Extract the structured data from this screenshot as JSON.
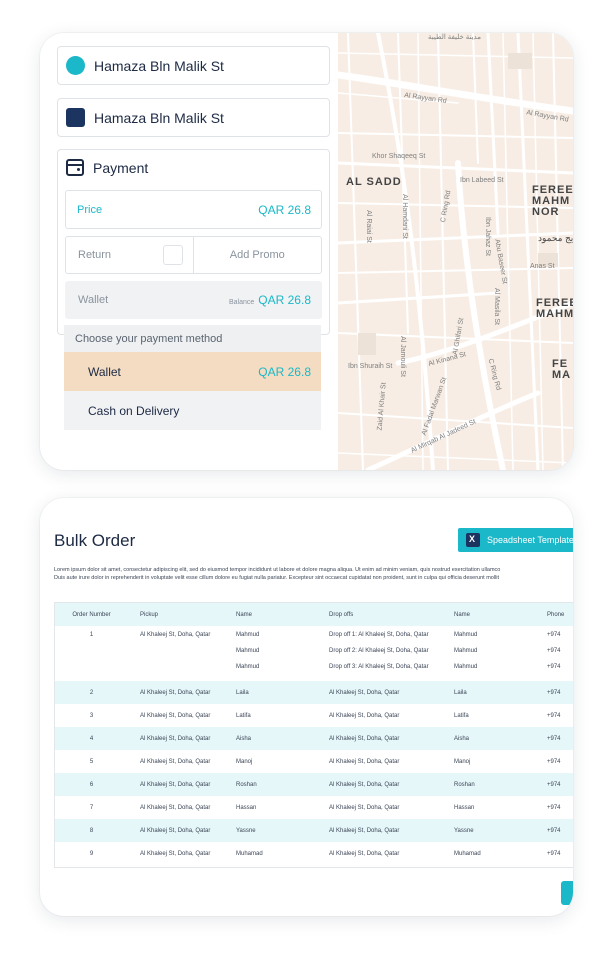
{
  "addresses": [
    {
      "label": "Hamaza Bln Malik St",
      "marker": "pickup-circle",
      "color": "#1ab8c9"
    },
    {
      "label": "Hamaza Bln Malik St",
      "marker": "dropoff-square",
      "color": "#1c3460"
    }
  ],
  "payment": {
    "title": "Payment",
    "price_label": "Price",
    "price_value": "QAR 26.8",
    "return_label": "Return",
    "promo_label": "Add Promo",
    "wallet_label": "Wallet",
    "balance_label": "Balance",
    "balance_value": "QAR 26.8",
    "method_title": "Choose your payment method",
    "methods": [
      {
        "label": "Wallet",
        "value": "QAR 26.8",
        "selected": true
      },
      {
        "label": "Cash on Delivery",
        "value": "",
        "selected": false
      }
    ]
  },
  "map": {
    "labels": {
      "top": "مدينة خليفة الطيبة",
      "al_rayyan_rd": "Al Rayyan Rd",
      "al_rayyan_rd2": "Al Rayyan Rd",
      "khor_shaqeeq": "Khor Shaqeeq St",
      "al_sadd": "AL SADD",
      "ibn_labeed": "Ibn Labeed St",
      "c_ring_rd": "C Ring Rd",
      "c_ring_rd2": "C Ring Rd",
      "fereej1": "FEREE MAHM NOR",
      "fereej_ar": "فريج محمود",
      "anas": "Anas St",
      "fereej2": "FEREE MAHM",
      "fereej3": "FE MA",
      "al_kinana": "Al Kinana St",
      "ibn_shuraih": "Ibn Shuraih St",
      "al_mirqab": "Al Mirqab Al Jadeed St",
      "al_fadal": "Al Fadal Marwan St",
      "zaid_al_khair": "Zaid Al Khair St",
      "al_hamdani": "Al Hamdani St",
      "al_raiai": "Al Raiai St",
      "al_jamouli": "Al Jamouli St",
      "al_masila": "Al Masila St",
      "ibn_jahaz": "Ibn Jahaz St",
      "abu_baseer": "Abu Baseer St",
      "al_ghifari": "Al Ghifari St"
    }
  },
  "bulk": {
    "title": "Bulk Order",
    "sheet_button": "Speadsheet Template",
    "sheet_icon": "excel-icon",
    "lorem1": "Lorem ipsum dolor sit amet, consectetur adipiscing elit, sed do eiusmod tempor incididunt ut labore et dolore magna aliqua. Ut enim ad minim veniam, quis nostrud exercitation ullamco",
    "lorem2": "Duis aute irure dolor in reprehenderit in voluptate velit esse cillum dolore eu fugiat nulla pariatur. Excepteur sint occaecat cupidatat non proident, sunt in culpa qui officia deserunt mollit",
    "columns": [
      "Order Number",
      "Pickup",
      "Name",
      "Drop offs",
      "Name",
      "Phone"
    ],
    "first_row": {
      "num": "1",
      "pickup": "Al Khaleej St, Doha, Qatar",
      "names": [
        "Mahmud",
        "Mahmud",
        "Mahmud"
      ],
      "drops": [
        "Drop off 1:  Al Khaleej St, Doha, Qatar",
        "Drop off 2:  Al Khaleej St, Doha, Qatar",
        "Drop off 3:  Al Khaleej St, Doha, Qatar"
      ],
      "names2": [
        "Mahmud",
        "Mahmud",
        "Mahmud"
      ],
      "phones": [
        "+974",
        "+974",
        "+974"
      ]
    },
    "rows": [
      {
        "num": "2",
        "pickup": "Al Khaleej St, Doha, Qatar",
        "name": "Laila",
        "drop": "Al Khaleej St, Doha, Qatar",
        "name2": "Laila",
        "phone": "+974"
      },
      {
        "num": "3",
        "pickup": "Al Khaleej St, Doha, Qatar",
        "name": "Latifa",
        "drop": "Al Khaleej St, Doha, Qatar",
        "name2": "Latifa",
        "phone": "+974"
      },
      {
        "num": "4",
        "pickup": "Al Khaleej St, Doha, Qatar",
        "name": "Aisha",
        "drop": "Al Khaleej St, Doha, Qatar",
        "name2": "Aisha",
        "phone": "+974"
      },
      {
        "num": "5",
        "pickup": "Al Khaleej St, Doha, Qatar",
        "name": "Manoj",
        "drop": "Al Khaleej St, Doha, Qatar",
        "name2": "Manoj",
        "phone": "+974"
      },
      {
        "num": "6",
        "pickup": "Al Khaleej St, Doha, Qatar",
        "name": "Roshan",
        "drop": "Al Khaleej St, Doha, Qatar",
        "name2": "Roshan",
        "phone": "+974"
      },
      {
        "num": "7",
        "pickup": "Al Khaleej St, Doha, Qatar",
        "name": "Hassan",
        "drop": "Al Khaleej St, Doha, Qatar",
        "name2": "Hassan",
        "phone": "+974"
      },
      {
        "num": "8",
        "pickup": "Al Khaleej St, Doha, Qatar",
        "name": "Yassne",
        "drop": "Al Khaleej St, Doha, Qatar",
        "name2": "Yassne",
        "phone": "+974"
      },
      {
        "num": "9",
        "pickup": "Al Khaleej St, Doha, Qatar",
        "name": "Muhamad",
        "drop": "Al Khaleej St, Doha, Qatar",
        "name2": "Muhamad",
        "phone": "+974"
      }
    ]
  },
  "colors": {
    "accent": "#1ab8c9",
    "navy": "#1c3460",
    "selected_method": "#f3dcc2",
    "row_alt": "#e6f7f9"
  }
}
